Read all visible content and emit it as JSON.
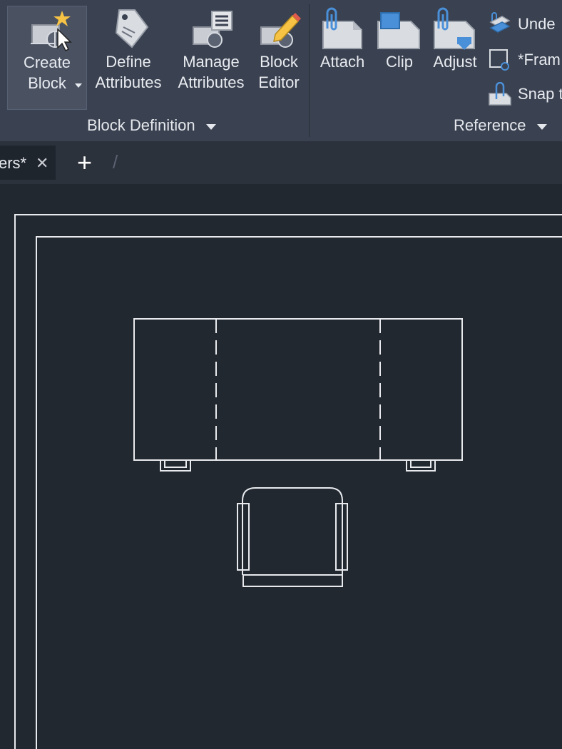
{
  "ribbon": {
    "panels": {
      "block_definition": {
        "title": "Block Definition",
        "tools": {
          "create_block": {
            "line1": "Create",
            "line2": "Block"
          },
          "define_attributes": {
            "line1": "Define",
            "line2": "Attributes"
          },
          "manage_attributes": {
            "line1": "Manage",
            "line2": "Attributes"
          },
          "block_editor": {
            "line1": "Block",
            "line2": "Editor"
          }
        }
      },
      "reference": {
        "title": "Reference",
        "tools": {
          "attach": "Attach",
          "clip": "Clip",
          "adjust": "Adjust",
          "underlay_layers": "Unde",
          "frames": "*Fram",
          "snap": "Snap t"
        }
      }
    }
  },
  "tabs": {
    "active_tab_label": "ers*",
    "close_glyph": "✕",
    "new_tab_glyph": "+",
    "separator_glyph": "/"
  },
  "colors": {
    "ribbon_bg": "#3a4150",
    "canvas_bg": "#212830",
    "drawing_lines": "#e8eaee",
    "accent_yellow": "#f6c344",
    "accent_blue": "#4a90d9",
    "accent_red": "#e15b4d"
  }
}
